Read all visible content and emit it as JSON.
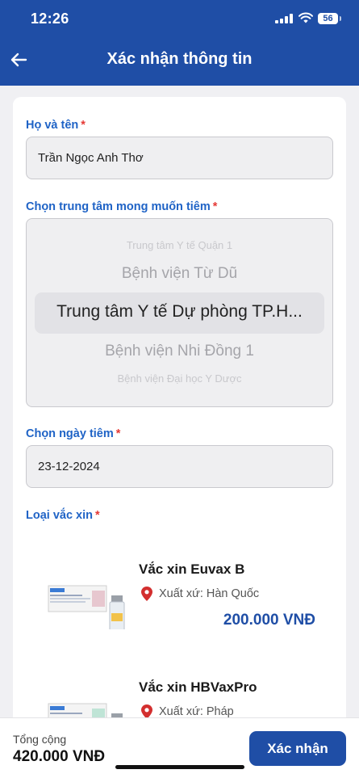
{
  "status_bar": {
    "time": "12:26",
    "battery": "56"
  },
  "header": {
    "title": "Xác nhận thông tin"
  },
  "form": {
    "name_label": "Họ và tên",
    "name_value": "Trần Ngọc Anh Thơ",
    "center_label": "Chọn trung tâm mong muốn tiêm",
    "center_options": [
      "Trung tâm Y tế Quận 1",
      "Bệnh viện Từ Dũ",
      "Trung tâm Y tế Dự phòng TP.H...",
      "Bệnh viện Nhi Đồng 1",
      "Bệnh viện Đại học Y Dược"
    ],
    "center_selected": "Trung tâm Y tế Dự phòng TP.H...",
    "date_label": "Chọn ngày tiêm",
    "date_value": "23-12-2024",
    "vaccine_label": "Loại vắc xin",
    "required_mark": "*"
  },
  "vaccines": [
    {
      "name": "Vắc xin Euvax B",
      "origin": "Xuất xứ: Hàn Quốc",
      "price": "200.000 VNĐ",
      "box_label": "Euvax B"
    },
    {
      "name": "Vắc xin HBVaxPro",
      "origin": "Xuất xứ: Pháp",
      "box_label": "Euvax B"
    }
  ],
  "footer": {
    "total_label": "Tổng cộng",
    "total_value": "420.000 VNĐ",
    "confirm_label": "Xác nhận"
  },
  "colors": {
    "primary": "#1f4ea6",
    "label_blue": "#1f63c6",
    "required_red": "#e53935",
    "pin_red": "#d32f2f"
  },
  "icons": [
    "back-arrow-icon",
    "signal-icon",
    "wifi-icon",
    "battery-icon",
    "location-pin-icon"
  ]
}
